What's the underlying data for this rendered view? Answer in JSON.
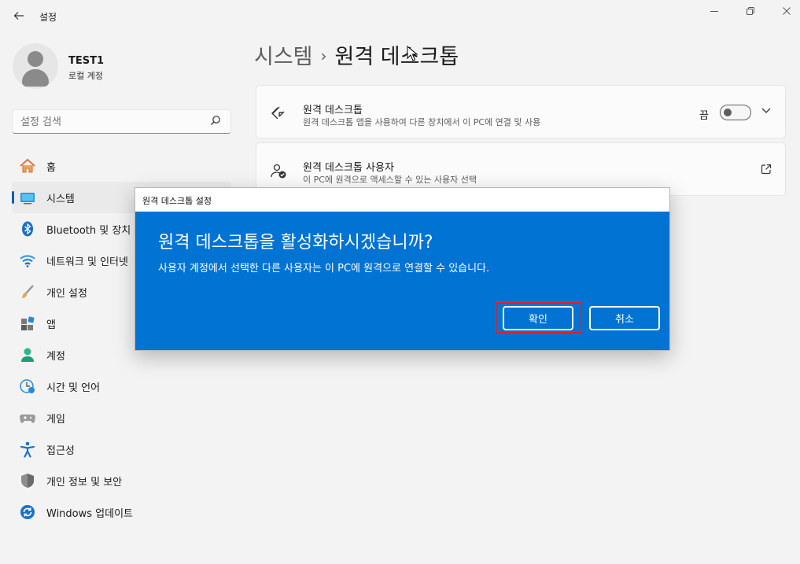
{
  "window": {
    "title": "설정",
    "back_icon": "arrow-left-icon",
    "minimize_icon": "minimize-icon",
    "maximize_icon": "restore-icon",
    "close_icon": "close-icon"
  },
  "profile": {
    "name": "TEST1",
    "account_type": "로컬 계정"
  },
  "search": {
    "placeholder": "설정 검색",
    "icon": "search-icon"
  },
  "sidebar": {
    "items": [
      {
        "label": "홈",
        "icon": "home-icon"
      },
      {
        "label": "시스템",
        "icon": "system-icon",
        "selected": true
      },
      {
        "label": "Bluetooth 및 장치",
        "icon": "bluetooth-icon"
      },
      {
        "label": "네트워크 및 인터넷",
        "icon": "wifi-icon"
      },
      {
        "label": "개인 설정",
        "icon": "brush-icon"
      },
      {
        "label": "앱",
        "icon": "apps-icon"
      },
      {
        "label": "계정",
        "icon": "accounts-icon"
      },
      {
        "label": "시간 및 언어",
        "icon": "time-language-icon"
      },
      {
        "label": "게임",
        "icon": "gaming-icon"
      },
      {
        "label": "접근성",
        "icon": "accessibility-icon"
      },
      {
        "label": "개인 정보 및 보안",
        "icon": "shield-icon"
      },
      {
        "label": "Windows 업데이트",
        "icon": "update-icon"
      }
    ],
    "accent_color": "#005fb8"
  },
  "breadcrumb": {
    "parent": "시스템",
    "separator": "›",
    "current": "원격 데스크톱"
  },
  "cards": [
    {
      "title": "원격 데스크톱",
      "description": "원격 데스크톱 앱을 사용하여 다른 장치에서 이 PC에 연결 및 사용",
      "icon": "remote-desktop-icon",
      "toggle_label": "끔",
      "toggle_on": false,
      "expand_icon": "chevron-down-icon"
    },
    {
      "title": "원격 데스크톱 사용자",
      "description": "이 PC에 원격으로 액세스할 수 있는 사용자 선택",
      "icon": "remote-users-icon",
      "action_icon": "open-external-icon"
    }
  ],
  "dialog": {
    "title": "원격 데스크톱 설정",
    "heading": "원격 데스크톱을 활성화하시겠습니까?",
    "message": "사용자 계정에서 선택한 다른 사용자는 이 PC에 원격으로 연결할 수 있습니다.",
    "confirm_label": "확인",
    "cancel_label": "취소",
    "background_color": "#0173d3",
    "highlight_color": "#e0202a"
  }
}
